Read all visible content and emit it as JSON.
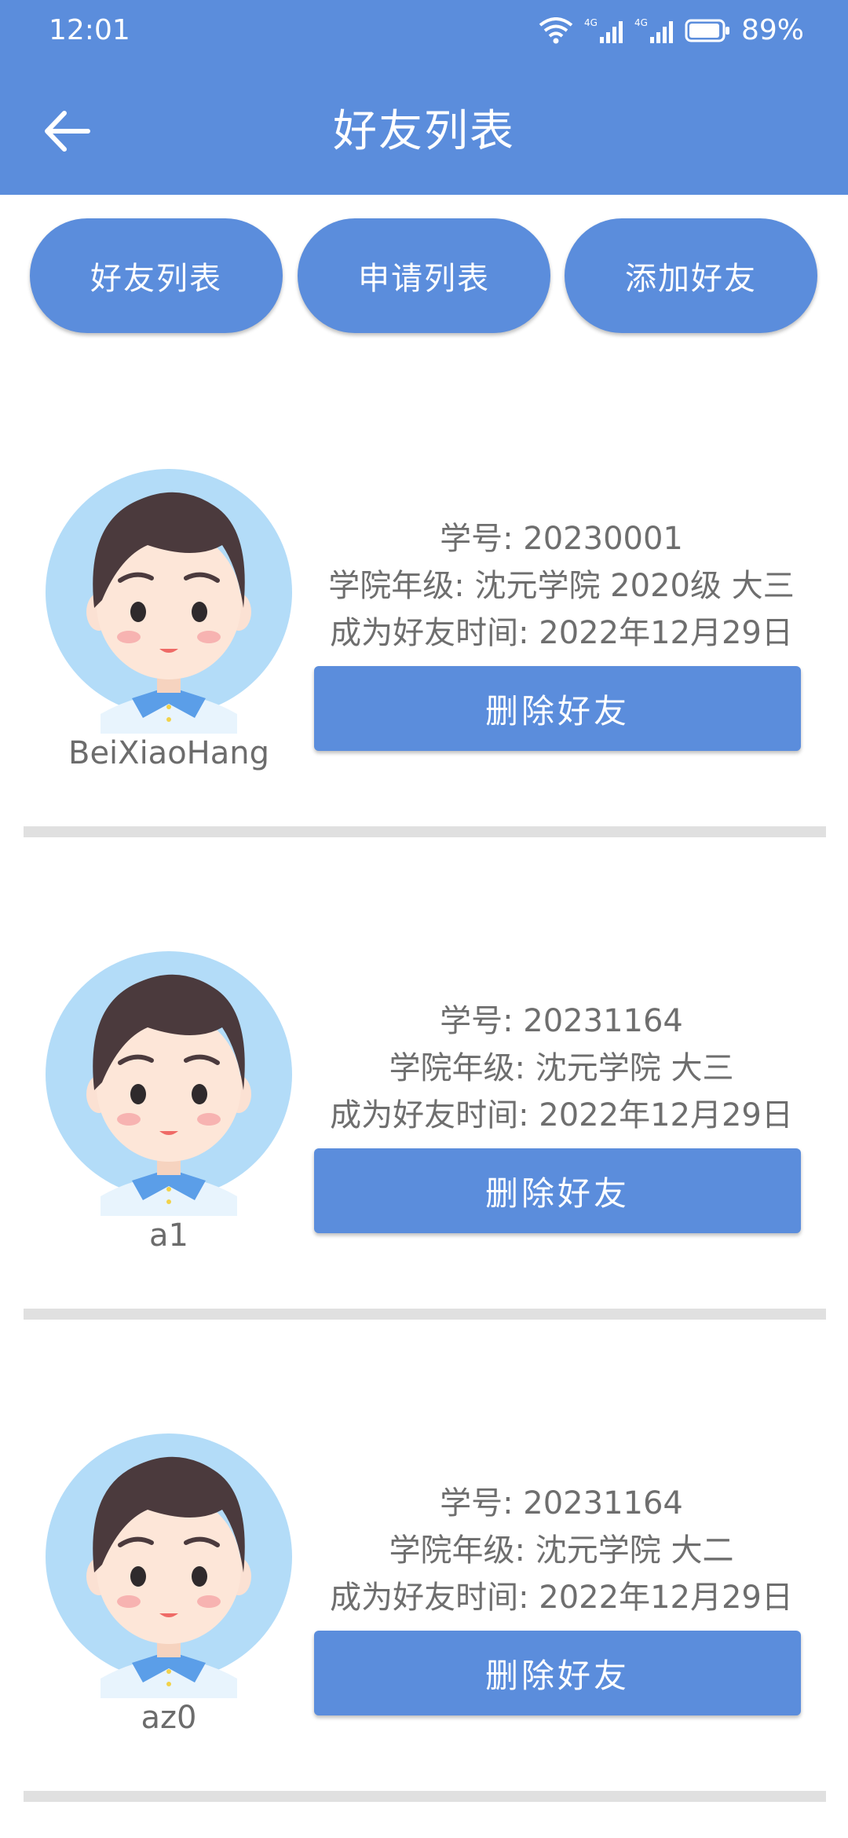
{
  "status_bar": {
    "time": "12:01",
    "battery": "89%",
    "network_label": "4G"
  },
  "header": {
    "title": "好友列表"
  },
  "tabs": [
    {
      "label": "好友列表"
    },
    {
      "label": "申请列表"
    },
    {
      "label": "添加好友"
    }
  ],
  "friends": [
    {
      "username": "BeiXiaoHang",
      "student_id": "学号: 20230001",
      "college_grade": "学院年级: 沈元学院 2020级 大三",
      "friend_since": "成为好友时间: 2022年12月29日",
      "delete_label": "删除好友"
    },
    {
      "username": "a1",
      "student_id": "学号: 20231164",
      "college_grade": "学院年级: 沈元学院 大三",
      "friend_since": "成为好友时间: 2022年12月29日",
      "delete_label": "删除好友"
    },
    {
      "username": "az0",
      "student_id": "学号: 20231164",
      "college_grade": "学院年级: 沈元学院 大二",
      "friend_since": "成为好友时间: 2022年12月29日",
      "delete_label": "删除好友"
    }
  ],
  "colors": {
    "primary": "#5b8ddc",
    "divider": "#e0e0e0",
    "text_gray": "#6e6e6e"
  }
}
